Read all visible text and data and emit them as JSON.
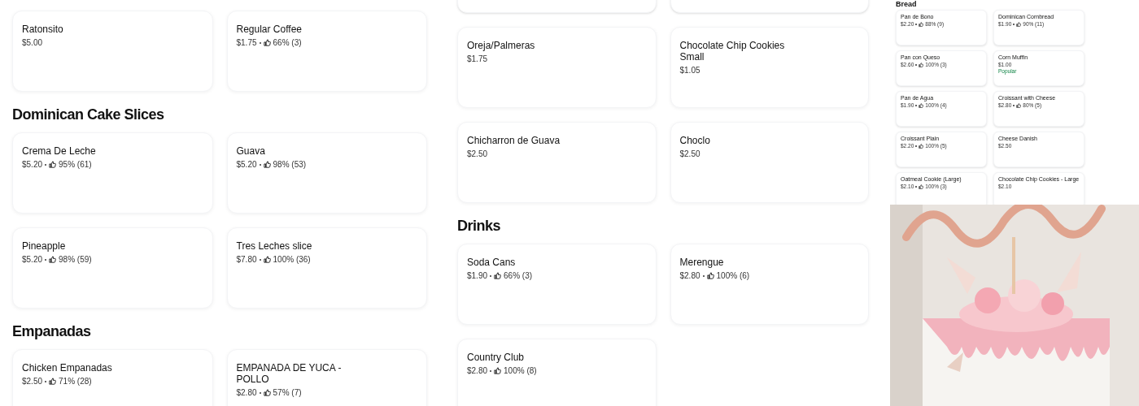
{
  "left_column": {
    "sections": [
      {
        "items": [
          {
            "name": "Ratonsito",
            "price": "$5.00"
          },
          {
            "name": "Regular Coffee",
            "price": "$1.75",
            "rating": "66% (3)"
          }
        ]
      },
      {
        "heading": "Dominican Cake Slices",
        "items": [
          {
            "name": "Crema De Leche",
            "price": "$5.20",
            "rating": "95% (61)"
          },
          {
            "name": "Guava",
            "price": "$5.20",
            "rating": "98% (53)"
          },
          {
            "name": "Pineapple",
            "price": "$5.20",
            "rating": "98% (59)"
          },
          {
            "name": "Tres Leches slice",
            "price": "$7.80",
            "rating": "100% (36)"
          }
        ]
      },
      {
        "heading": "Empanadas",
        "items": [
          {
            "name": "Chicken Empanadas",
            "price": "$2.50",
            "rating": "71% (28)"
          },
          {
            "name": "EMPANADA DE YUCA - POLLO",
            "price": "$2.80",
            "rating": "57% (7)"
          }
        ]
      }
    ]
  },
  "middle_column": {
    "sections": [
      {
        "items": [
          {
            "name": "Oreja/Palmeras",
            "price": "$1.75"
          },
          {
            "name": "Chocolate Chip Cookies Small",
            "price": "$1.05"
          },
          {
            "name": "Chicharron de Guava",
            "price": "$2.50"
          },
          {
            "name": "Choclo",
            "price": "$2.50"
          }
        ]
      },
      {
        "heading": "Drinks",
        "items": [
          {
            "name": "Soda Cans",
            "price": "$1.90",
            "rating": "66% (3)"
          },
          {
            "name": "Merengue",
            "price": "$2.80",
            "rating": "100% (6)"
          },
          {
            "name": "Country Club",
            "price": "$2.80",
            "rating": "100% (8)"
          }
        ]
      }
    ]
  },
  "thumbnail": {
    "heading": "Bread",
    "items": [
      {
        "name": "Pan de Bono",
        "price": "$2.20",
        "rating": "88% (9)"
      },
      {
        "name": "Dominican Cornbread",
        "price": "$1.90",
        "rating": "90% (11)"
      },
      {
        "name": "Pan con Queso",
        "price": "$2.60",
        "rating": "100% (3)"
      },
      {
        "name": "Corn Muffin",
        "price": "$1.00",
        "badge": "Popular"
      },
      {
        "name": "Pan de Agua",
        "price": "$1.90",
        "rating": "100% (4)"
      },
      {
        "name": "Croissant with Cheese",
        "price": "$2.80",
        "rating": "80% (5)"
      },
      {
        "name": "Croissant Plain",
        "price": "$2.20",
        "rating": "100% (5)"
      },
      {
        "name": "Cheese Danish",
        "price": "$2.50"
      },
      {
        "name": "Oatmeal Cookie (Large)",
        "price": "$2.10",
        "rating": "100% (3)"
      },
      {
        "name": "Chocolate Chip Cookies - Large",
        "price": "$2.10"
      }
    ]
  }
}
